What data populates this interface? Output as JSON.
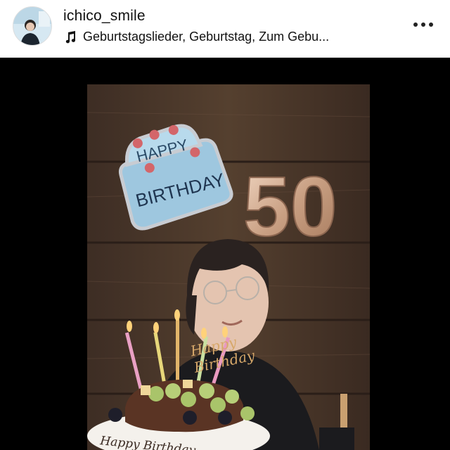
{
  "post": {
    "username": "ichico_smile",
    "audio_title": "Geburtstagslieder, Geburtstag, Zum Gebu...",
    "icons": {
      "music": "music-note-icon",
      "more": "more-options-icon"
    }
  },
  "photo": {
    "balloon_text_line1": "HAPPY",
    "balloon_text_line2": "BIRTHDAY",
    "number_balloons": "50",
    "cake_topper_line1": "Happy",
    "cake_topper_line2": "Birthday",
    "cake_plate_text": "Happy Birthday"
  },
  "colors": {
    "header_bg": "#ffffff",
    "background": "#000000",
    "wood": "#4a372c",
    "gold": "#d8b79a"
  }
}
